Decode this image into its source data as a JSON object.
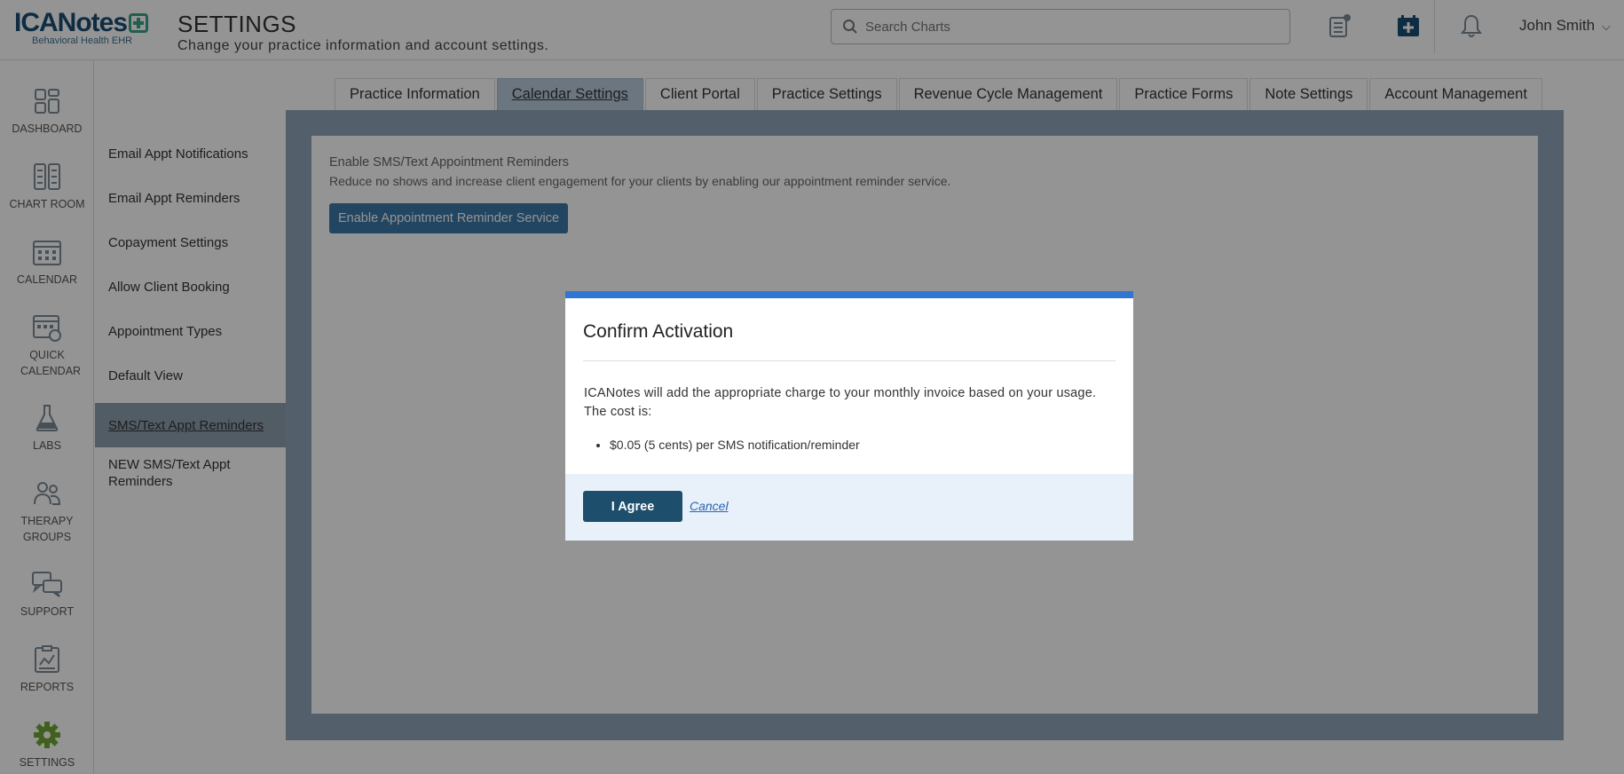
{
  "header": {
    "logo_main": "ICANotes",
    "logo_sub": "Behavioral Health EHR",
    "title": "SETTINGS",
    "subtitle": "Change your practice information and account settings.",
    "search_placeholder": "Search Charts",
    "user_name": "John Smith",
    "icons": [
      "add-chart-icon",
      "add-calendar-icon",
      "bell-icon",
      "search-icon",
      "chevron-down-icon"
    ]
  },
  "leftnav": {
    "items": [
      {
        "label": "DASHBOARD",
        "icon": "dashboard-icon"
      },
      {
        "label": "CHART ROOM",
        "icon": "chart-room-icon"
      },
      {
        "label": "CALENDAR",
        "icon": "calendar-icon"
      },
      {
        "label": "QUICK CALENDAR",
        "icon": "quick-calendar-icon"
      },
      {
        "label": "LABS",
        "icon": "flask-icon"
      },
      {
        "label": "THERAPY GROUPS",
        "icon": "therapy-groups-icon"
      },
      {
        "label": "SUPPORT",
        "icon": "support-chat-icon"
      },
      {
        "label": "REPORTS",
        "icon": "reports-icon"
      },
      {
        "label": "SETTINGS",
        "icon": "gear-icon"
      }
    ],
    "active": "SETTINGS",
    "active_color": "#6fa832"
  },
  "tabs": [
    {
      "label": "Practice Information"
    },
    {
      "label": "Calendar Settings",
      "active": true
    },
    {
      "label": "Client Portal"
    },
    {
      "label": "Practice Settings"
    },
    {
      "label": "Revenue Cycle Management"
    },
    {
      "label": "Practice Forms"
    },
    {
      "label": "Note Settings"
    },
    {
      "label": "Account Management"
    }
  ],
  "subnav": {
    "items": [
      {
        "label": "Email Appt Notifications"
      },
      {
        "label": "Email Appt Reminders"
      },
      {
        "label": "Copayment Settings"
      },
      {
        "label": "Allow Client Booking"
      },
      {
        "label": "Appointment Types"
      },
      {
        "label": "Default View"
      },
      {
        "label": "SMS/Text Appt Reminders",
        "active": true
      },
      {
        "label": "NEW SMS/Text Appt Reminders"
      }
    ]
  },
  "content": {
    "section_title": "Enable SMS/Text Appointment Reminders",
    "section_desc": "Reduce no shows and increase client engagement for your clients by enabling our appointment reminder service.",
    "enable_button": "Enable Appointment Reminder Service"
  },
  "modal": {
    "title": "Confirm Activation",
    "text_line1": "ICANotes will add the appropriate charge to your monthly invoice based on your usage.",
    "text_line2": "The cost is:",
    "cost_item": "$0.05 (5 cents) per SMS notification/reminder",
    "agree_button": "I Agree",
    "cancel_link": "Cancel",
    "accent_color": "#2f76d2"
  }
}
